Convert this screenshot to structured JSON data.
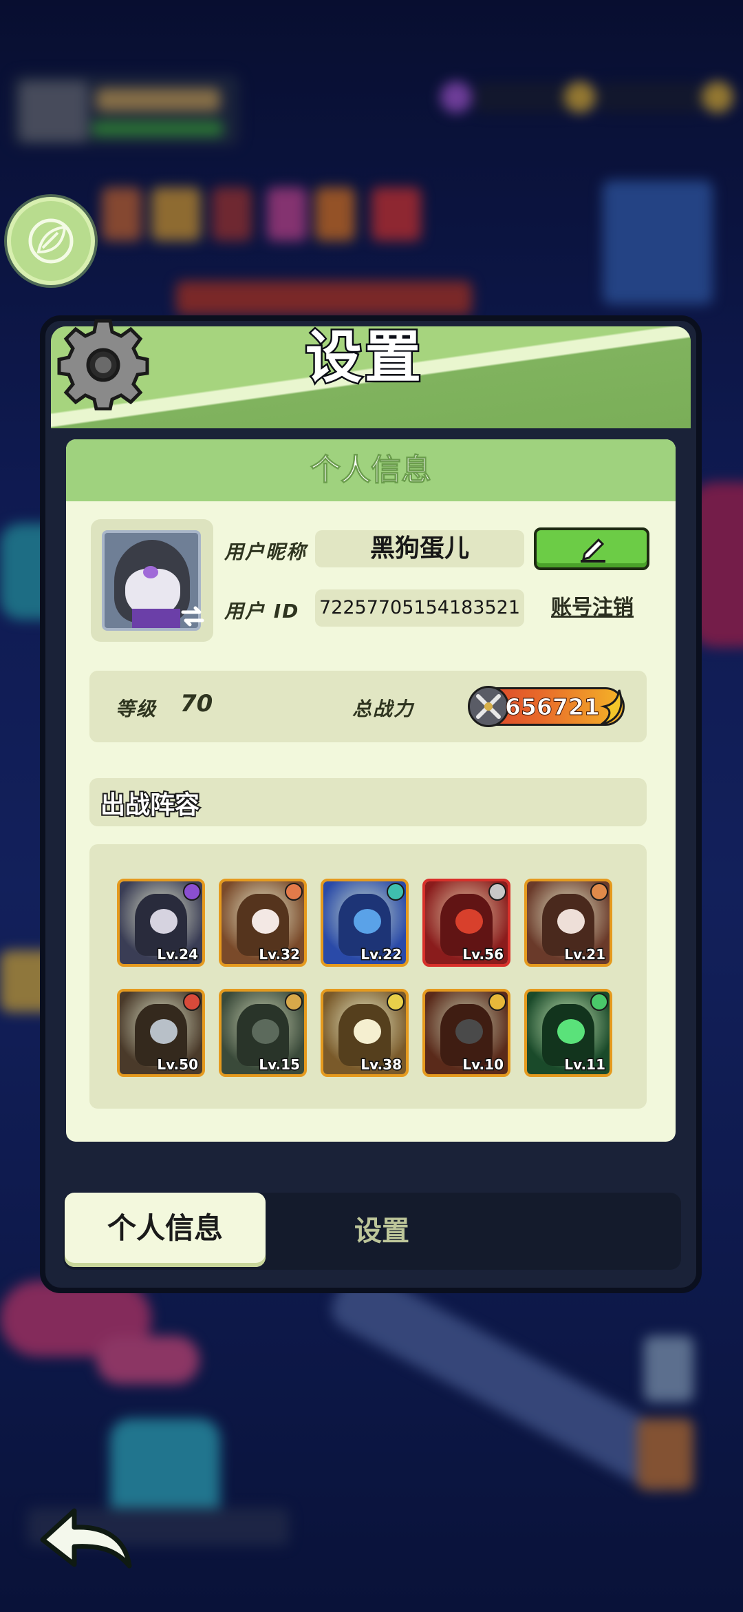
{
  "panel": {
    "title": "设置"
  },
  "profile": {
    "section_title": "个人信息",
    "nickname_label": "用户昵称",
    "nickname": "黑狗蛋儿",
    "id_label": "用户 ID",
    "user_id": "72257705154183521",
    "deregister_label": "账号注销",
    "level_label": "等级",
    "level": "70",
    "power_label": "总战力",
    "power": "656721"
  },
  "lineup": {
    "title": "出战阵容",
    "heroes": [
      {
        "level": "Lv.24",
        "theme": "#3a3d55",
        "accent": "#d6d3e0",
        "element": "#8a4fd0"
      },
      {
        "level": "Lv.32",
        "theme": "#7a4a2a",
        "accent": "#f3e8e4",
        "element": "#e37a4a"
      },
      {
        "level": "Lv.22",
        "theme": "#2a4aa8",
        "accent": "#5aa2e8",
        "element": "#3fbfae"
      },
      {
        "level": "Lv.56",
        "theme": "#8a1c1c",
        "accent": "#d8402c",
        "element": "#c8c8c8"
      },
      {
        "level": "Lv.21",
        "theme": "#6a3a2a",
        "accent": "#eedfd8",
        "element": "#e08a4a"
      },
      {
        "level": "Lv.50",
        "theme": "#4a3a2a",
        "accent": "#b8c0c8",
        "element": "#d84a3a"
      },
      {
        "level": "Lv.15",
        "theme": "#3a4a3a",
        "accent": "#5c6a5c",
        "element": "#d8a84a"
      },
      {
        "level": "Lv.38",
        "theme": "#7a5a2a",
        "accent": "#f5efd0",
        "element": "#e8d04a"
      },
      {
        "level": "Lv.10",
        "theme": "#5a2a1a",
        "accent": "#4a4a4a",
        "element": "#e8b83a"
      },
      {
        "level": "Lv.11",
        "theme": "#1a4a2a",
        "accent": "#5ae27a",
        "element": "#4ac86a"
      }
    ]
  },
  "tabs": {
    "active": "个人信息",
    "inactive": "设置"
  },
  "colors": {
    "header_green": "#8bc36a",
    "card_bg": "#f2f8dc",
    "edit_button": "#6ccc46",
    "hero_border": "#e59a1e"
  },
  "icons": [
    "gear-icon",
    "pencil-edit-icon",
    "swap-avatar-icon",
    "crossed-swords-icon",
    "leaf-icon",
    "back-arrow-icon"
  ]
}
